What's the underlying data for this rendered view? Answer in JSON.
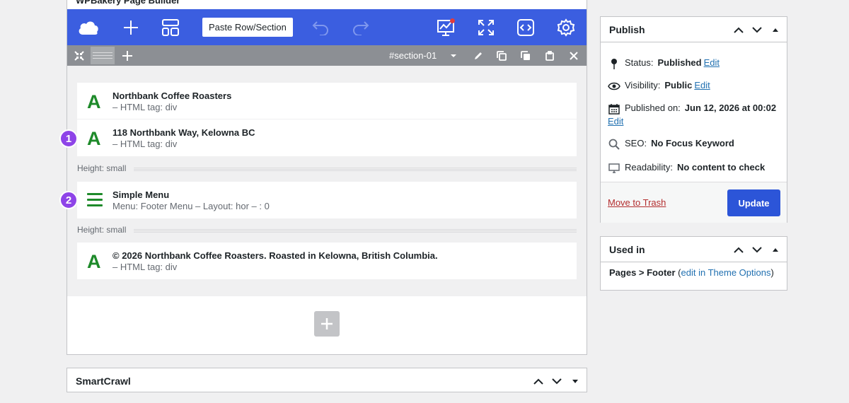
{
  "builder": {
    "title": "WPBakery Page Builder",
    "paste_label": "Paste Row/Section",
    "section_id": "#section-01",
    "elements": [
      {
        "title": "Northbank Coffee Roasters",
        "sub": "– HTML tag: div"
      },
      {
        "title": "118 Northbank Way, Kelowna BC",
        "sub": "– HTML tag: div"
      },
      {
        "title": "Simple Menu",
        "sub": "Menu: Footer Menu – Layout: hor – : 0"
      },
      {
        "title": "© 2026 Northbank Coffee Roasters. Roasted in Kelowna, British Columbia.",
        "sub": "– HTML tag: div"
      }
    ],
    "height_label_1": "Height: small",
    "height_label_2": "Height: small",
    "badge_1": "1",
    "badge_2": "2",
    "element_glyph": "A"
  },
  "smartcrawl": {
    "title": "SmartCrawl"
  },
  "publish": {
    "title": "Publish",
    "status_label": "Status:",
    "status_value": "Published",
    "status_edit": "Edit",
    "visibility_label": "Visibility:",
    "visibility_value": "Public",
    "visibility_edit": "Edit",
    "published_label": "Published on:",
    "published_value": "Jun 12, 2026 at 00:02",
    "published_edit": "Edit",
    "seo_label": "SEO:",
    "seo_value": "No Focus Keyword",
    "readability_label": "Readability:",
    "readability_value": "No content to check",
    "trash_label": "Move to Trash",
    "update_label": "Update"
  },
  "usedin": {
    "title": "Used in",
    "pages_text": "Pages > Footer",
    "open_paren": " (",
    "link_text": "edit in Theme Options",
    "close_paren": ")"
  },
  "colors": {
    "toolbar": "#3b5ee0",
    "section_bar": "#8c8f94",
    "element_green": "#1e8a2a",
    "badge_purple": "#8e44e8",
    "update_button": "#2c55d8",
    "link_blue": "#2271b1",
    "trash_red": "#b32d2e"
  },
  "icons": {
    "toolbar": [
      "cloud-icon",
      "plus-icon",
      "layout-template-icon",
      "undo-icon",
      "redo-icon",
      "presentation-chart-icon",
      "fullscreen-icon",
      "code-icon",
      "gear-icon"
    ],
    "section_bar": [
      "collapse-icon",
      "drag-handle",
      "plus-icon",
      "chevron-down-icon",
      "pencil-icon",
      "copy-icon",
      "clone-icon",
      "paste-icon",
      "close-icon"
    ]
  }
}
